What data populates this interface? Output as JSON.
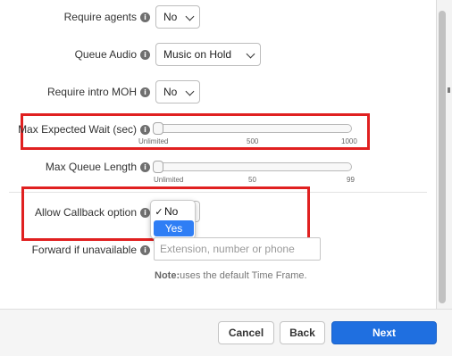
{
  "form": {
    "require_agents": {
      "label": "Require agents",
      "value": "No"
    },
    "queue_audio": {
      "label": "Queue Audio",
      "value": "Music on Hold"
    },
    "require_intro_moh": {
      "label": "Require intro MOH",
      "value": "No"
    },
    "max_expected_wait": {
      "label": "Max Expected Wait (sec)",
      "ticks": [
        "Unlimited",
        "500",
        "1000"
      ],
      "value": "Unlimited"
    },
    "max_queue_length": {
      "label": "Max Queue Length",
      "ticks": [
        "Unlimited",
        "50",
        "99"
      ],
      "value": "Unlimited"
    },
    "allow_callback": {
      "label": "Allow Callback option",
      "selected": "No",
      "options": [
        "No",
        "Yes"
      ]
    },
    "forward_if_unavailable": {
      "label": "Forward if unavailable",
      "placeholder": "Extension, number or phone",
      "value": ""
    },
    "note": {
      "bold": "Note:",
      "text": "uses the default Time Frame."
    }
  },
  "info_glyph": "i",
  "check_glyph": "✓",
  "footer": {
    "cancel": "Cancel",
    "back": "Back",
    "next": "Next"
  },
  "colors": {
    "highlight": "#e02020",
    "primary": "#1f6fe0",
    "dropdown_selected": "#2f7ef5"
  },
  "icons": [
    "info-icon",
    "chevron-down-icon",
    "checkmark-icon"
  ]
}
